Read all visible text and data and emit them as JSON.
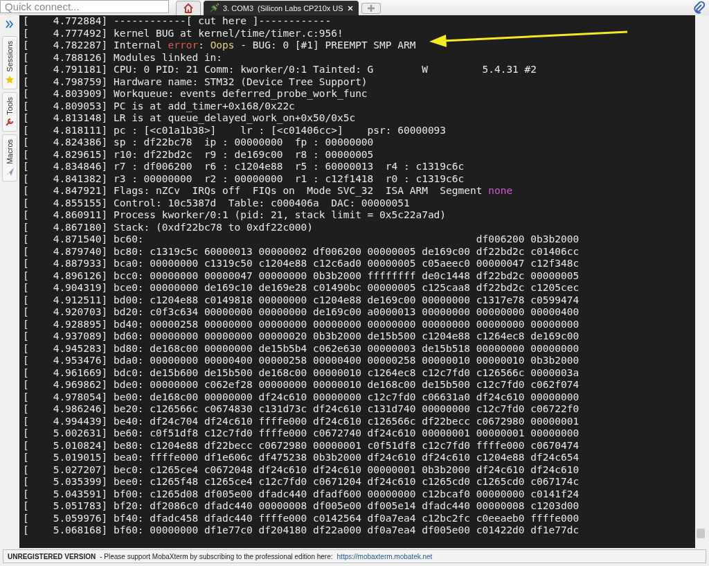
{
  "quick_connect": {
    "placeholder": "Quick connect..."
  },
  "tabs": [
    {
      "kind": "home",
      "selected": false
    },
    {
      "kind": "session",
      "title": "3. COM3  (Silicon Labs CP210x US",
      "selected": true
    }
  ],
  "sidebar": {
    "items": [
      {
        "label": "Sessions"
      },
      {
        "label": "Tools"
      },
      {
        "label": "Macros"
      }
    ]
  },
  "terminal": {
    "lines": [
      {
        "text": "[    4.772884] ------------[ cut here ]------------"
      },
      {
        "text": "[    4.777492] kernel BUG at kernel/time/timer.c:956!"
      },
      {
        "segments": [
          {
            "kind": "plain",
            "text": "[    4.782287] Internal "
          },
          {
            "kind": "error",
            "text": "error"
          },
          {
            "kind": "plain",
            "text": ": "
          },
          {
            "kind": "warning",
            "text": "Oops"
          },
          {
            "kind": "plain",
            "text": " - BUG: 0 [#1] PREEMPT SMP ARM"
          }
        ]
      },
      {
        "text": "[    4.788126] Modules linked in:"
      },
      {
        "text": "[    4.791181] CPU: 0 PID: 21 Comm: kworker/0:1 Tainted: G        W         5.4.31 #2"
      },
      {
        "text": "[    4.798759] Hardware name: STM32 (Device Tree Support)"
      },
      {
        "text": "[    4.803909] Workqueue: events deferred_probe_work_func"
      },
      {
        "text": "[    4.809053] PC is at add_timer+0x168/0x22c"
      },
      {
        "text": "[    4.813148] LR is at queue_delayed_work_on+0x50/0x5c"
      },
      {
        "text": "[    4.818111] pc : [<c01a1b38>]    lr : [<c01406cc>]    psr: 60000093"
      },
      {
        "text": "[    4.824386] sp : df22bc78  ip : 00000000  fp : 00000000"
      },
      {
        "text": "[    4.829615] r10: df22bd2c  r9 : de169c00  r8 : 00000005"
      },
      {
        "text": "[    4.834846] r7 : df006200  r6 : c1204e88  r5 : 60000013  r4 : c1319c6c"
      },
      {
        "text": "[    4.841382] r3 : 00000000  r2 : 00000000  r1 : c12f1418  r0 : c1319c6c"
      },
      {
        "segments": [
          {
            "kind": "plain",
            "text": "[    4.847921] Flags: nZCv  IRQs off  FIQs on  Mode SVC_32  ISA ARM  Segment "
          },
          {
            "kind": "keyword",
            "text": "none"
          }
        ]
      },
      {
        "text": "[    4.855155] Control: 10c5387d  Table: c000406a  DAC: 00000051"
      },
      {
        "text": "[    4.860911] Process kworker/0:1 (pid: 21, stack limit = 0x5c22a7ad)"
      },
      {
        "text": "[    4.867180] Stack: (0xdf22bc78 to 0xdf22c000)"
      },
      {
        "text": "[    4.871540] bc60:                                                       df006200 0b3b2000"
      },
      {
        "text": "[    4.879740] bc80: c1319c5c 60000013 00000002 df006200 00000005 de169c00 df22bd2c c01406cc"
      },
      {
        "text": "[    4.887933] bca0: 00000000 c1319c50 c1204e88 c12c6ad0 00000005 c05aeec0 00000047 c12f348c"
      },
      {
        "text": "[    4.896126] bcc0: 00000000 00000047 00000000 0b3b2000 ffffffff de0c1448 df22bd2c 00000005"
      },
      {
        "text": "[    4.904319] bce0: 00000000 de169c10 de169e28 c01490bc 00000005 c125caa8 df22bd2c c1205cec"
      },
      {
        "text": "[    4.912511] bd00: c1204e88 c0149818 00000000 c1204e88 de169c00 00000000 c1317e78 c0599474"
      },
      {
        "text": "[    4.920703] bd20: c0f3c634 00000000 00000000 de169c00 a0000013 00000000 00000000 00000400"
      },
      {
        "text": "[    4.928895] bd40: 00000258 00000000 00000000 00000000 00000000 00000000 00000000 00000000"
      },
      {
        "text": "[    4.937089] bd60: 00000000 00000000 00000020 0b3b2000 de15b500 c1204e88 c1264ec8 de169c00"
      },
      {
        "text": "[    4.945283] bd80: de168c00 00000000 de15b5b4 c062e630 00000003 de15b518 00000000 00000000"
      },
      {
        "text": "[    4.953476] bda0: 00000000 00000400 00000258 00000400 00000258 00000010 00000010 0b3b2000"
      },
      {
        "text": "[    4.961669] bdc0: de15b600 de15b500 de168c00 00000010 c1264ec8 c12c7fd0 c126566c 0000003a"
      },
      {
        "text": "[    4.969862] bde0: 00000000 c062ef28 00000000 00000010 de168c00 de15b500 c12c7fd0 c062f074"
      },
      {
        "text": "[    4.978054] be00: de168c00 00000000 df24c610 00000000 c12c7fd0 c06631a0 df24c610 00000000"
      },
      {
        "text": "[    4.986246] be20: c126566c c0674830 c131d73c df24c610 c131d740 00000000 c12c7fd0 c06722f0"
      },
      {
        "text": "[    4.994439] be40: df24c704 df24c610 ffffe000 df24c610 c126566c df22becc c0672980 00000001"
      },
      {
        "text": "[    5.002631] be60: c0f51df8 c12c7fd0 ffffe000 c0672740 df24c610 00000001 00000001 00000000"
      },
      {
        "text": "[    5.010824] be80: c1204e88 df22becc c0672980 00000001 c0f51df8 c12c7fd0 ffffe000 c0670474"
      },
      {
        "text": "[    5.019015] bea0: ffffe000 df1e606c df475238 0b3b2000 df24c610 df24c610 c1204e88 df24c654"
      },
      {
        "text": "[    5.027207] bec0: c1265ce4 c0672048 df24c610 df24c610 00000001 0b3b2000 df24c610 df24c610"
      },
      {
        "text": "[    5.035399] bee0: c1265f48 c1265ce4 c12c7fd0 c0671204 df24c610 c1265cd0 c1265cd0 c067174c"
      },
      {
        "text": "[    5.043591] bf00: c1265d08 df005e00 dfadc440 dfadf600 00000000 c12bcaf0 00000000 c0141f24"
      },
      {
        "text": "[    5.051783] bf20: df2086c0 dfadc440 00000008 df005e00 df005e14 dfadc440 00000008 c1203d00"
      },
      {
        "text": "[    5.059976] bf40: dfadc458 dfadc440 ffffe000 c0142564 df0a7ea4 c12bc2fc c0eeaeb0 ffffe000"
      },
      {
        "text": "[    5.068168] bf60: 00000000 df1e77c0 df204180 df22a000 df0a7ea4 df005e00 c01422d0 df1e77dc"
      }
    ]
  },
  "status_bar": {
    "label": "UNREGISTERED VERSION",
    "message": "-  Please support MobaXterm by subscribing to the professional edition here:",
    "link": "https://mobaxterm.mobatek.net"
  }
}
